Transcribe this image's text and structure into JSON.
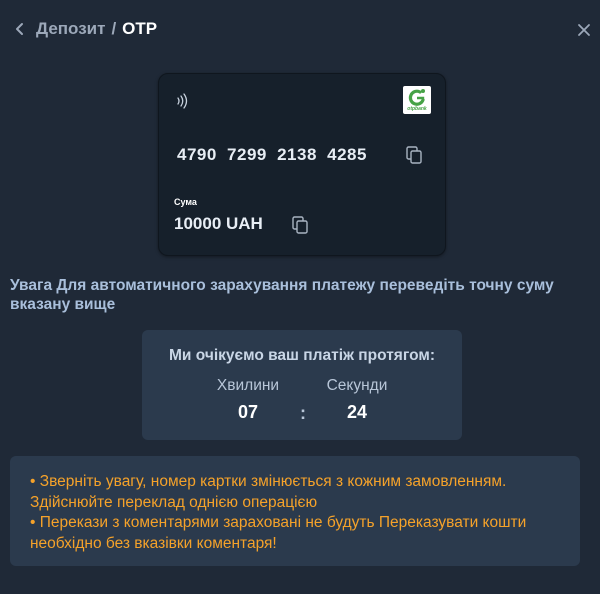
{
  "header": {
    "icons": {
      "back": "chevron-left-icon",
      "close": "close-icon"
    },
    "breadcrumb_parent": "Депозит",
    "breadcrumb_separator": "/",
    "breadcrumb_current": "OTP"
  },
  "card": {
    "icons": {
      "contactless": "contactless-icon",
      "copy": "copy-icon"
    },
    "bank_logo_text": "otpbank",
    "number": "4790 7299 2138 4285",
    "amount_label": "Сума",
    "amount_value": "10000 UAH"
  },
  "notice": "Увага Для автоматичного зарахування платежу переведіть точну суму вказану вище",
  "timer": {
    "title": "Ми очікуємо ваш платіж протягом:",
    "minutes_label": "Хвилини",
    "seconds_label": "Секунди",
    "minutes_value": "07",
    "seconds_value": "24",
    "separator": ":"
  },
  "warning": {
    "line1": "• Зверніть увагу, номер картки змінюється з кожним замовленням. Здійснюйте переклад однією операцією",
    "line2": "• Перекази з коментарями зараховані не будуть Переказувати кошти необхідно без вказівки коментаря!"
  },
  "colors": {
    "background": "#1f2937",
    "panel": "#2b3a4d",
    "card": "#16202b",
    "warning_text": "#f5a22a",
    "notice_text": "#a9bfdb",
    "bank_green": "#46a246"
  }
}
